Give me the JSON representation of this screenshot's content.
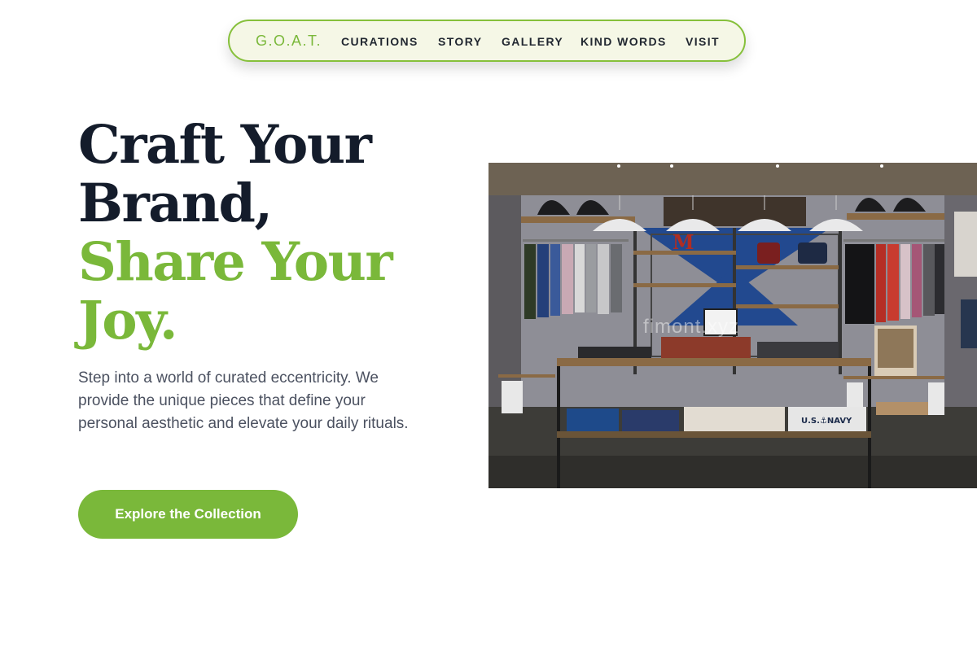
{
  "nav": {
    "logo": "G.O.A.T.",
    "items": [
      "CURATIONS",
      "STORY",
      "GALLERY",
      "KIND WORDS",
      "VISIT"
    ],
    "accent_color": "#86c03b"
  },
  "hero": {
    "headline_dark_1": "Craft Your",
    "headline_dark_2": "Brand,",
    "headline_green_1": "Share Your",
    "headline_green_2": "Joy.",
    "description": "Step into a world of curated eccentricity. We provide the unique pieces that define your personal aesthetic and elevate your daily rituals.",
    "cta_label": "Explore the Collection",
    "accent_color": "#7ab83a"
  },
  "image": {
    "alt": "clothing-store-interior",
    "watermark": "fimont.xyz",
    "sign_letter": "M",
    "shirt_text": "U.S.⚓NAVY"
  }
}
